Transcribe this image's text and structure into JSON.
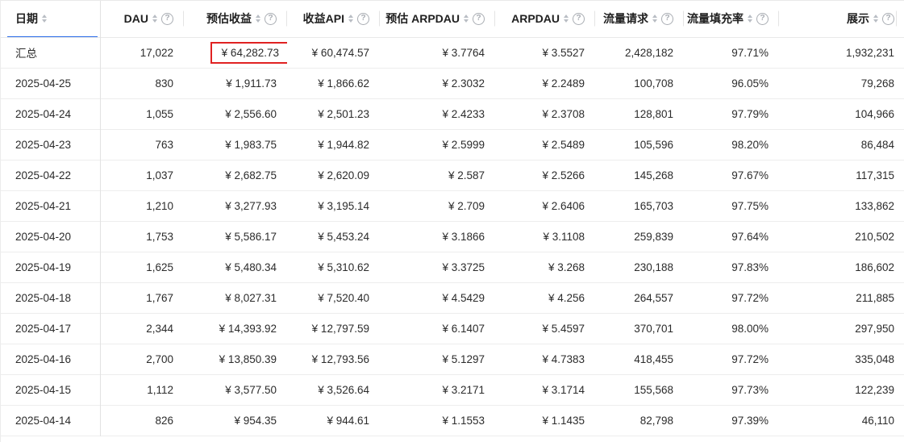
{
  "colors": {
    "accent_blue": "#2b6de9",
    "highlight_red": "#e02222"
  },
  "table": {
    "columns": [
      {
        "key": "date",
        "label": "日期",
        "align": "left",
        "sortable": true,
        "help": false,
        "active": true
      },
      {
        "key": "dau",
        "label": "DAU",
        "align": "right",
        "sortable": true,
        "help": true,
        "active": false
      },
      {
        "key": "estimated-revenue",
        "label": "预估收益",
        "align": "right",
        "sortable": true,
        "help": true,
        "active": false
      },
      {
        "key": "revenue-api",
        "label": "收益API",
        "align": "right",
        "sortable": true,
        "help": true,
        "active": false
      },
      {
        "key": "estimated-arpdau",
        "label": "预估 ARPDAU",
        "align": "right",
        "sortable": true,
        "help": true,
        "active": false
      },
      {
        "key": "arpdau",
        "label": "ARPDAU",
        "align": "right",
        "sortable": true,
        "help": true,
        "active": false
      },
      {
        "key": "traffic-requests",
        "label": "流量请求",
        "align": "right",
        "sortable": true,
        "help": true,
        "active": false
      },
      {
        "key": "fill-rate",
        "label": "流量填充率",
        "align": "right",
        "sortable": true,
        "help": true,
        "active": false
      },
      {
        "key": "impressions",
        "label": "展示",
        "align": "right",
        "sortable": true,
        "help": true,
        "active": false
      }
    ],
    "rows": [
      [
        "汇总",
        "17,022",
        "¥ 64,282.73",
        "¥ 60,474.57",
        "¥ 3.7764",
        "¥ 3.5527",
        "2,428,182",
        "97.71%",
        "1,932,231"
      ],
      [
        "2025-04-25",
        "830",
        "¥ 1,911.73",
        "¥ 1,866.62",
        "¥ 2.3032",
        "¥ 2.2489",
        "100,708",
        "96.05%",
        "79,268"
      ],
      [
        "2025-04-24",
        "1,055",
        "¥ 2,556.60",
        "¥ 2,501.23",
        "¥ 2.4233",
        "¥ 2.3708",
        "128,801",
        "97.79%",
        "104,966"
      ],
      [
        "2025-04-23",
        "763",
        "¥ 1,983.75",
        "¥ 1,944.82",
        "¥ 2.5999",
        "¥ 2.5489",
        "105,596",
        "98.20%",
        "86,484"
      ],
      [
        "2025-04-22",
        "1,037",
        "¥ 2,682.75",
        "¥ 2,620.09",
        "¥ 2.587",
        "¥ 2.5266",
        "145,268",
        "97.67%",
        "117,315"
      ],
      [
        "2025-04-21",
        "1,210",
        "¥ 3,277.93",
        "¥ 3,195.14",
        "¥ 2.709",
        "¥ 2.6406",
        "165,703",
        "97.75%",
        "133,862"
      ],
      [
        "2025-04-20",
        "1,753",
        "¥ 5,586.17",
        "¥ 5,453.24",
        "¥ 3.1866",
        "¥ 3.1108",
        "259,839",
        "97.64%",
        "210,502"
      ],
      [
        "2025-04-19",
        "1,625",
        "¥ 5,480.34",
        "¥ 5,310.62",
        "¥ 3.3725",
        "¥ 3.268",
        "230,188",
        "97.83%",
        "186,602"
      ],
      [
        "2025-04-18",
        "1,767",
        "¥ 8,027.31",
        "¥ 7,520.40",
        "¥ 4.5429",
        "¥ 4.256",
        "264,557",
        "97.72%",
        "211,885"
      ],
      [
        "2025-04-17",
        "2,344",
        "¥ 14,393.92",
        "¥ 12,797.59",
        "¥ 6.1407",
        "¥ 5.4597",
        "370,701",
        "98.00%",
        "297,950"
      ],
      [
        "2025-04-16",
        "2,700",
        "¥ 13,850.39",
        "¥ 12,793.56",
        "¥ 5.1297",
        "¥ 4.7383",
        "418,455",
        "97.72%",
        "335,048"
      ],
      [
        "2025-04-15",
        "1,112",
        "¥ 3,577.50",
        "¥ 3,526.64",
        "¥ 3.2171",
        "¥ 3.1714",
        "155,568",
        "97.73%",
        "122,239"
      ],
      [
        "2025-04-14",
        "826",
        "¥ 954.35",
        "¥ 944.61",
        "¥ 1.1553",
        "¥ 1.1435",
        "82,798",
        "97.39%",
        "46,110"
      ]
    ],
    "highlight_cell": {
      "row": 0,
      "col": 2
    }
  }
}
